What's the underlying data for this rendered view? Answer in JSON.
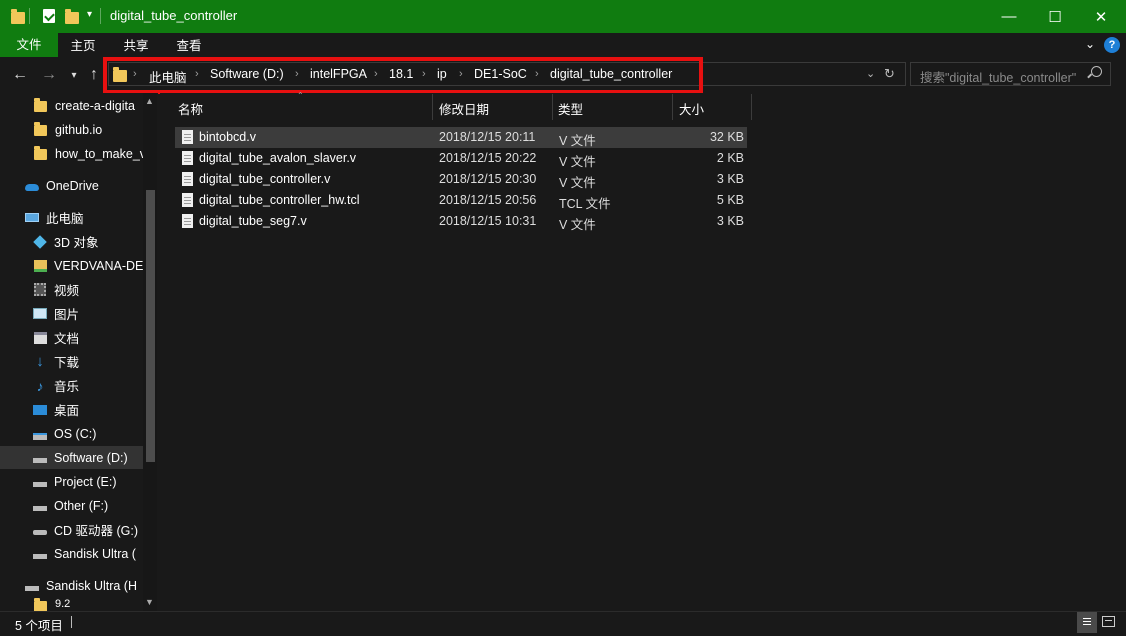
{
  "window": {
    "title": "digital_tube_controller",
    "minimize": "—",
    "maximize": "☐",
    "close": "✕"
  },
  "ribbon": {
    "tabs": [
      "文件",
      "主页",
      "共享",
      "查看"
    ],
    "expand_icon": "chevron-down-icon",
    "help": "?"
  },
  "address": {
    "crumbs": [
      "此电脑",
      "Software (D:)",
      "intelFPGA",
      "18.1",
      "ip",
      "DE1-SoC",
      "digital_tube_controller"
    ]
  },
  "search": {
    "placeholder": "搜索\"digital_tube_controller\""
  },
  "navpane": {
    "items": [
      {
        "label": "create-a-digita",
        "icon": "folder-icon"
      },
      {
        "label": "github.io",
        "icon": "folder-icon"
      },
      {
        "label": "how_to_make_v",
        "icon": "folder-icon"
      },
      {
        "label": "OneDrive",
        "icon": "cloud-icon"
      },
      {
        "label": "此电脑",
        "icon": "computer-icon"
      },
      {
        "label": "3D 对象",
        "icon": "cube-icon"
      },
      {
        "label": "VERDVANA-DE",
        "icon": "network-folder-icon"
      },
      {
        "label": "视频",
        "icon": "video-icon"
      },
      {
        "label": "图片",
        "icon": "pictures-icon"
      },
      {
        "label": "文档",
        "icon": "documents-icon"
      },
      {
        "label": "下载",
        "icon": "download-icon"
      },
      {
        "label": "音乐",
        "icon": "music-icon"
      },
      {
        "label": "桌面",
        "icon": "desktop-icon"
      },
      {
        "label": "OS (C:)",
        "icon": "drive-icon"
      },
      {
        "label": "Software (D:)",
        "icon": "drive-icon"
      },
      {
        "label": "Project (E:)",
        "icon": "drive-icon"
      },
      {
        "label": "Other (F:)",
        "icon": "drive-icon"
      },
      {
        "label": "CD 驱动器 (G:)",
        "icon": "cd-drive-icon"
      },
      {
        "label": "Sandisk Ultra (",
        "icon": "drive-icon"
      },
      {
        "label": "Sandisk Ultra (H",
        "icon": "drive-icon"
      },
      {
        "label": "9.2",
        "icon": "folder-icon"
      }
    ]
  },
  "filelist": {
    "columns": [
      "名称",
      "修改日期",
      "类型",
      "大小"
    ],
    "rows": [
      {
        "name": "bintobcd.v",
        "date": "2018/12/15 20:11",
        "type": "V 文件",
        "size": "32 KB"
      },
      {
        "name": "digital_tube_avalon_slaver.v",
        "date": "2018/12/15 20:22",
        "type": "V 文件",
        "size": "2 KB"
      },
      {
        "name": "digital_tube_controller.v",
        "date": "2018/12/15 20:30",
        "type": "V 文件",
        "size": "3 KB"
      },
      {
        "name": "digital_tube_controller_hw.tcl",
        "date": "2018/12/15 20:56",
        "type": "TCL 文件",
        "size": "5 KB"
      },
      {
        "name": "digital_tube_seg7.v",
        "date": "2018/12/15 10:31",
        "type": "V 文件",
        "size": "3 KB"
      }
    ]
  },
  "status": {
    "text": "5 个项目"
  },
  "colors": {
    "accent": "#107c10",
    "highlight_box": "#e81010"
  }
}
